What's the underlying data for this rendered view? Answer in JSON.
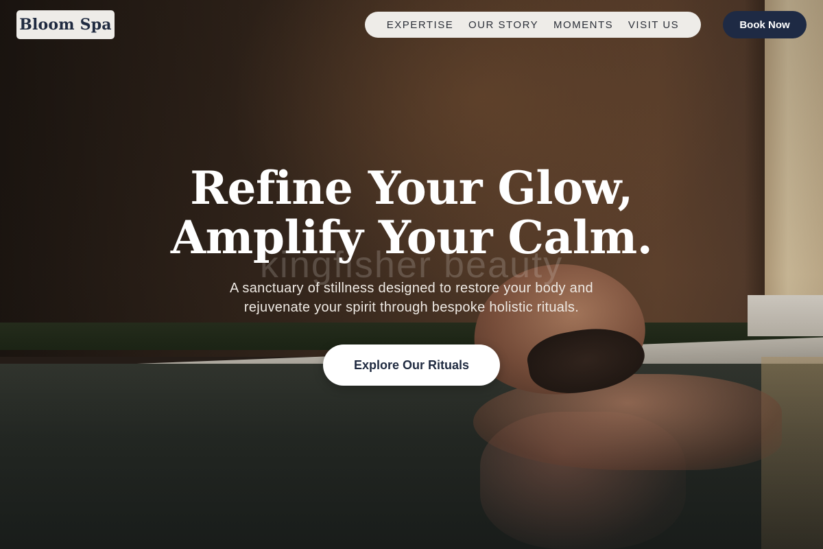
{
  "header": {
    "logo_text": "Bloom Spa",
    "nav": [
      {
        "label": "EXPERTISE"
      },
      {
        "label": "OUR STORY"
      },
      {
        "label": "MOMENTS"
      },
      {
        "label": "VISIT US"
      }
    ],
    "book_button": "Book Now"
  },
  "hero": {
    "headline_line1": "Refine Your Glow,",
    "headline_line2": "Amplify Your Calm.",
    "watermark": "kingfisher beauty",
    "subtitle_line1": "A sanctuary of stillness designed to restore your body and",
    "subtitle_line2": "rejuvenate your spirit through bespoke holistic rituals.",
    "cta_label": "Explore Our Rituals"
  },
  "colors": {
    "brand_navy": "#1e2a44",
    "pill_background": "#eeece8",
    "cta_background": "#ffffff"
  }
}
